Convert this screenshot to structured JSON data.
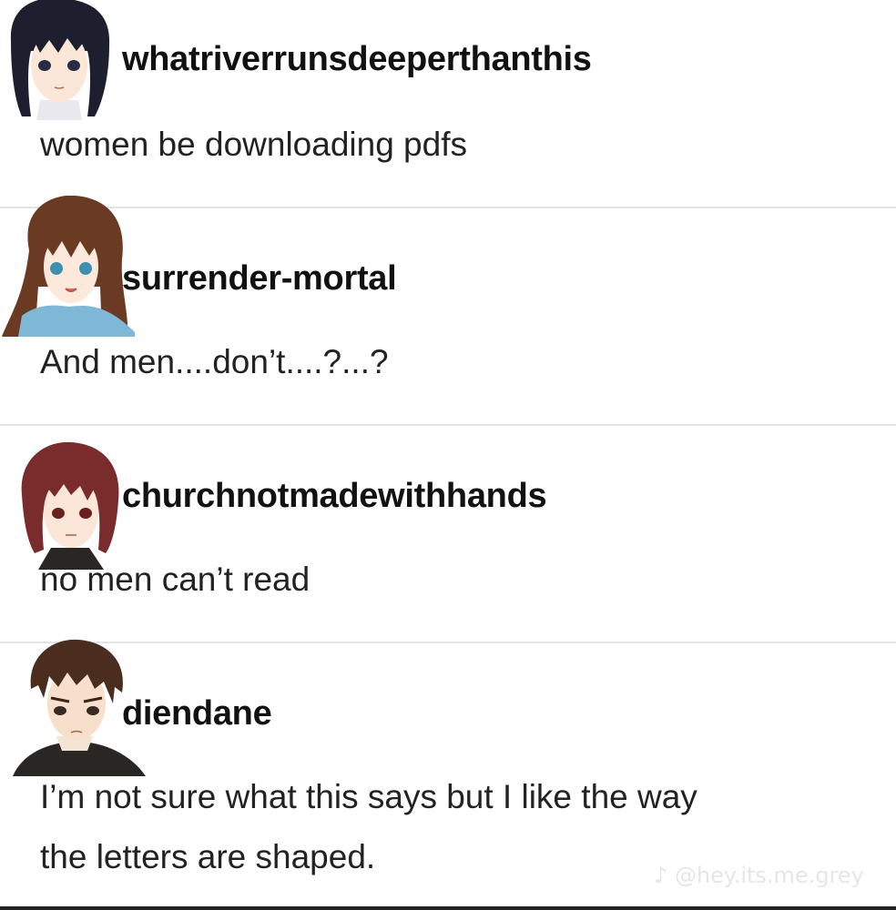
{
  "posts": [
    {
      "username": "whatriverrunsdeeperthanthis",
      "text": "women be downloading pdfs",
      "avatar": "dark-haired-girl-avatar"
    },
    {
      "username": "surrender-mortal",
      "text": "And men....don’t....?...?",
      "avatar": "brown-haired-girl-avatar"
    },
    {
      "username": "churchnotmadewithhands",
      "text": "no men can’t read",
      "avatar": "red-haired-girl-avatar"
    },
    {
      "username": "diendane",
      "text_line1": "I’m not sure what this says but I like the way",
      "text_line2": "the letters are shaped.",
      "avatar": "brown-haired-boy-avatar"
    }
  ],
  "watermark": "♪ @hey.its.me.grey"
}
